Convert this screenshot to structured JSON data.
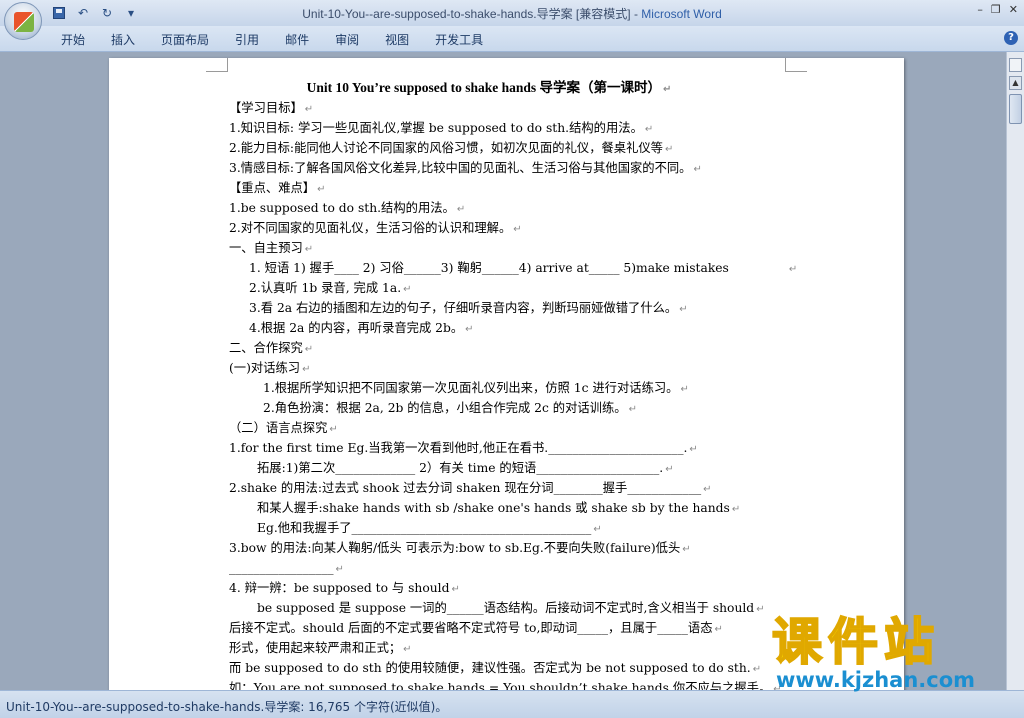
{
  "window": {
    "title": "Unit-10-You--are-supposed-to-shake-hands.导学案 [兼容模式] - ",
    "app_name": "Microsoft Word",
    "controls": [
      "–",
      "❐",
      "✕"
    ]
  },
  "ribbon": {
    "tabs": [
      "开始",
      "插入",
      "页面布局",
      "引用",
      "邮件",
      "审阅",
      "视图",
      "开发工具"
    ]
  },
  "document": {
    "title": "Unit 10 You’re supposed to shake hands 导学案（第一课时）",
    "lines": [
      "【学习目标】",
      "1.知识目标: 学习一些见面礼仪,掌握 be supposed to do sth.结构的用法。",
      "2.能力目标:能同他人讨论不同国家的风俗习惯，如初次见面的礼仪，餐桌礼仪等",
      "3.情感目标:了解各国风俗文化差异,比较中国的见面礼、生活习俗与其他国家的不同。",
      "【重点、难点】",
      "1.be supposed to do sth.结构的用法。",
      "2.对不同国家的见面礼仪，生活习俗的认识和理解。",
      "一、自主预习",
      "1. 短语    1) 握手____  2) 习俗______3) 鞠躬______4) arrive at_____  5)make mistakes",
      "2.认真听 1b 录音, 完成 1a.",
      "3.看 2a 右边的插图和左边的句子，仔细听录音内容，判断玛丽娅做错了什么。",
      "4.根据 2a 的内容，再听录音完成 2b。",
      "二、合作探究",
      "(一)对话练习",
      "1.根据所学知识把不同国家第一次见面礼仪列出来，仿照 1c 进行对话练习。",
      "2.角色扮演：根据 2a, 2b 的信息，小组合作完成 2c 的对话训练。",
      "（二）语言点探究",
      "1.for the first time Eg.当我第一次看到他时,他正在看书.______________________.",
      "拓展:1)第二次_____________  2）有关 time 的短语____________________.",
      "2.shake 的用法:过去式 shook 过去分词 shaken 现在分词________握手____________",
      "和某人握手:shake hands with sb /shake one's hands  或 shake sb by the hands",
      "Eg.他和我握手了_______________________________________",
      "3.bow 的用法:向某人鞠躬/低头 可表示为:bow to sb.Eg.不要向失败(failure)低头",
      "_________________",
      "4. 辩一辨：be supposed to  与 should",
      "be supposed 是 suppose 一词的______语态结构。后接动词不定式时,含义相当于 should",
      "后接不定式。should 后面的不定式要省略不定式符号 to,即动词_____，且属于_____语态",
      "形式，使用起来较严肃和正式；",
      "而 be supposed to do sth 的使用较随便，建议性强。否定式为 be not supposed to do sth.",
      "如：You are not supposed to shake hands.= You shouldn’t shake hands.你不应与之握手。"
    ]
  },
  "status_bar": {
    "text": "Unit-10-You--are-supposed-to-shake-hands.导学案: 16,765 个字符(近似值)。"
  },
  "watermark": {
    "big": "课件站",
    "url": "www.kjzhan.com"
  }
}
